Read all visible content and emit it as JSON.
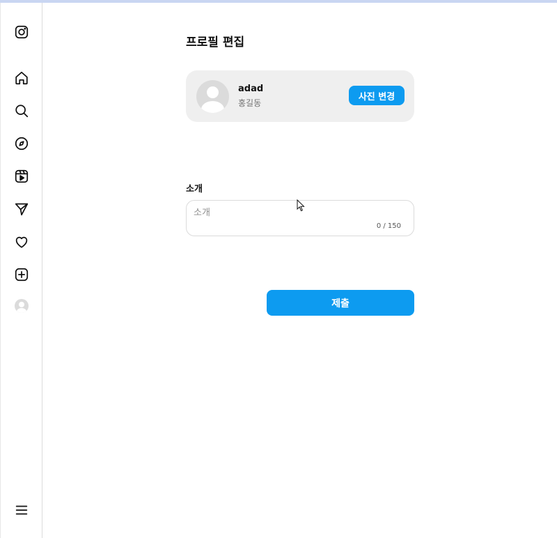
{
  "sidebar": {
    "icons": [
      "instagram-logo-icon",
      "home-icon",
      "search-icon",
      "explore-compass-icon",
      "reels-icon",
      "messages-send-icon",
      "notifications-heart-icon",
      "create-plus-icon",
      "profile-avatar-icon",
      "menu-hamburger-icon"
    ]
  },
  "page": {
    "title": "프로필 편집"
  },
  "profile": {
    "username": "adad",
    "full_name": "홍길동",
    "change_photo_label": "사진 변경"
  },
  "bio": {
    "label": "소개",
    "placeholder": "소개",
    "value": "",
    "counter": "0 / 150"
  },
  "form": {
    "submit_label": "제출"
  },
  "colors": {
    "accent": "#0d9bf0",
    "card_bg": "#efefef",
    "border": "#dbdbdb"
  }
}
